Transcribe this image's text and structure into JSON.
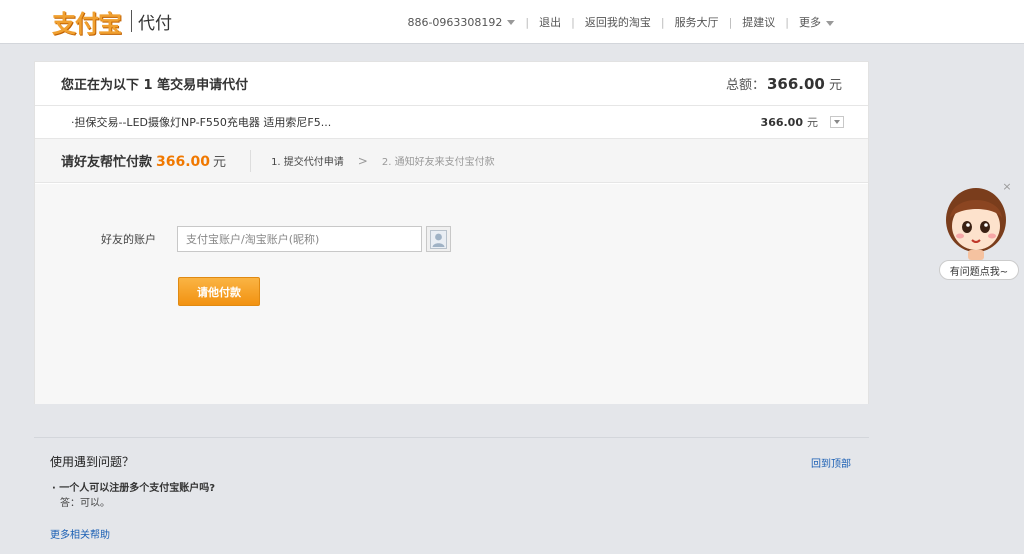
{
  "header": {
    "logo_text": "支付宝",
    "product_name": "代付",
    "nav": {
      "account": "886-0963308192",
      "logout": "退出",
      "back_to_taobao": "返回我的淘宝",
      "service_hall": "服务大厅",
      "feedback": "提建议",
      "more": "更多"
    },
    "separator": "|"
  },
  "panel": {
    "title": "您正在为以下 1 笔交易申请代付",
    "total_label": "总额：",
    "total_amount": "366.00",
    "total_unit": "元",
    "order": {
      "name": "·担保交易--LED摄像灯NP-F550充电器 适用索尼F5...",
      "amount": "366.00",
      "unit": "元"
    },
    "step_bar": {
      "title": "请好友帮忙付款",
      "amount": "366.00",
      "unit": "元",
      "steps": [
        {
          "label": "1. 提交代付申请"
        },
        {
          "label": "2. 通知好友来支付宝付款"
        }
      ],
      "arrow": ">"
    },
    "form": {
      "account_label": "好友的账户",
      "account_placeholder": "支付宝账户/淘宝账户(昵称)",
      "pay_button": "请他付款"
    }
  },
  "footer": {
    "help_title": "使用遇到问题？",
    "back_to_top": "回到顶部",
    "faq_question": "· 一个人可以注册多个支付宝账户吗?",
    "faq_answer": "答：可以。",
    "more_help": "更多相关帮助"
  },
  "mascot": {
    "bubble": "有问题点我~",
    "close": "×"
  },
  "colors": {
    "accent_orange": "#f07800",
    "button_orange": "#f29211",
    "link_blue": "#1a5fb4"
  }
}
